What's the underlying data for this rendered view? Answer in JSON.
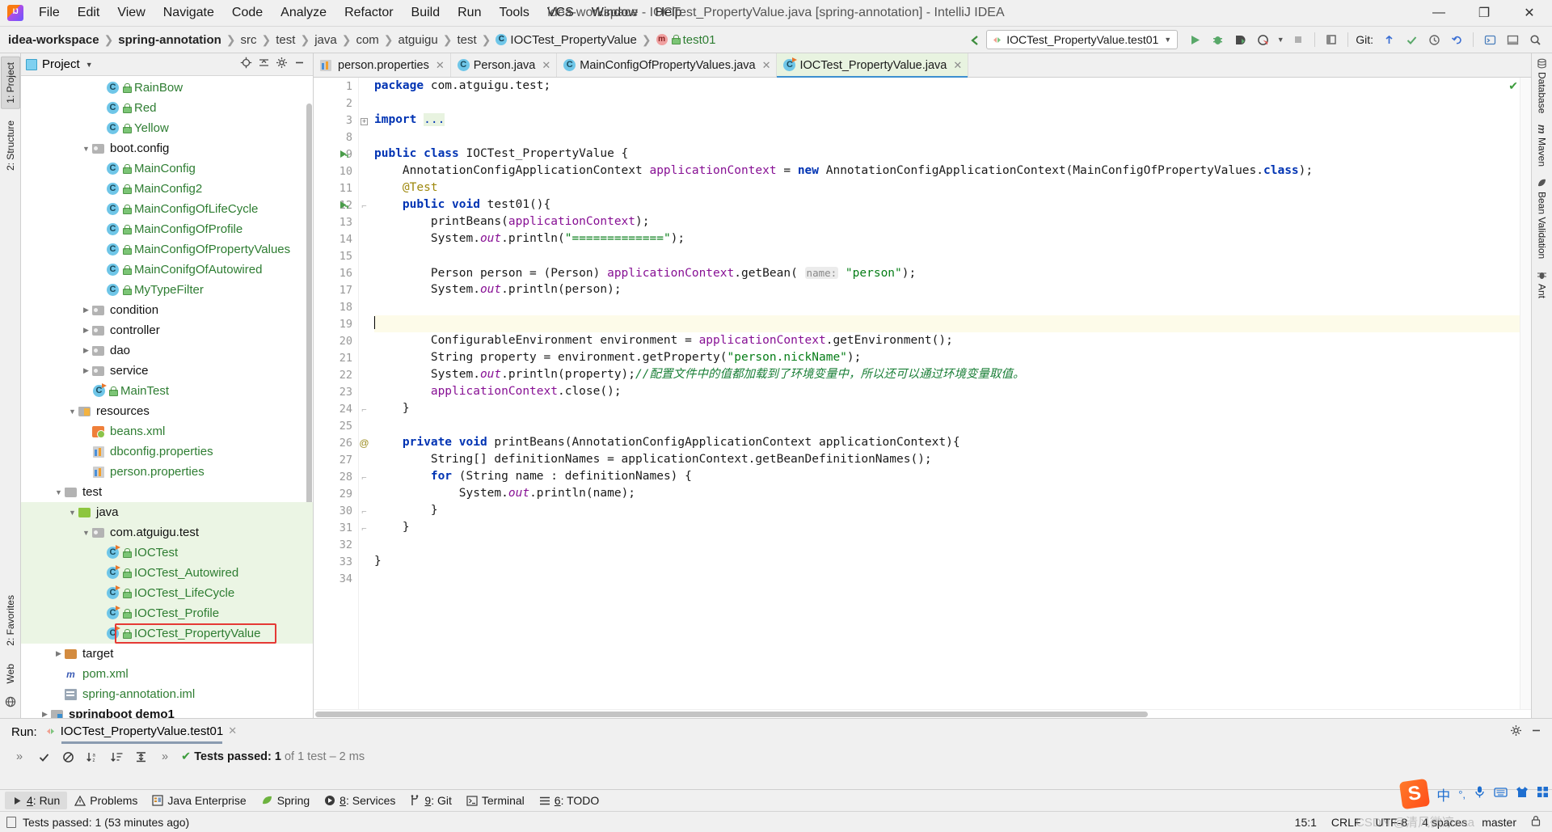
{
  "window": {
    "title": "idea-workspace - IOCTest_PropertyValue.java [spring-annotation] - IntelliJ IDEA",
    "minimize": "—",
    "maximize": "❐",
    "close": "✕"
  },
  "menu": [
    "File",
    "Edit",
    "View",
    "Navigate",
    "Code",
    "Analyze",
    "Refactor",
    "Build",
    "Run",
    "Tools",
    "VCS",
    "Window",
    "Help"
  ],
  "breadcrumb": [
    {
      "label": "idea-workspace",
      "style": "bold"
    },
    {
      "label": "spring-annotation",
      "style": "bold"
    },
    {
      "label": "src",
      "style": "dim"
    },
    {
      "label": "test",
      "style": "dim"
    },
    {
      "label": "java",
      "style": "dim"
    },
    {
      "label": "com",
      "style": "dim"
    },
    {
      "label": "atguigu",
      "style": "dim"
    },
    {
      "label": "test",
      "style": "dim"
    },
    {
      "label": "IOCTest_PropertyValue",
      "style": "class"
    },
    {
      "label": "test01",
      "style": "method"
    }
  ],
  "toolbar": {
    "run_config": "IOCTest_PropertyValue.test01",
    "git_label": "Git:",
    "icons": [
      "run-icon",
      "debug-icon",
      "run-coverage-icon",
      "profile-icon",
      "stop-icon",
      "update-project-icon",
      "commit-icon",
      "history-icon",
      "undo-icon",
      "search-everywhere-icon"
    ]
  },
  "left_rail": {
    "top": [
      {
        "label": "1: Project",
        "selected": true
      },
      {
        "label": "2: Structure",
        "selected": false
      }
    ],
    "bottom": [
      {
        "label": "2: Favorites"
      },
      {
        "label": "Web"
      }
    ]
  },
  "right_rail": [
    {
      "label": "Database",
      "icon": "database-icon"
    },
    {
      "label": "Maven",
      "icon": "maven-icon"
    },
    {
      "label": "Bean Validation",
      "icon": "bean-icon"
    },
    {
      "label": "Ant",
      "icon": "ant-icon"
    }
  ],
  "project_panel": {
    "title": "Project",
    "tools": [
      "locate-icon",
      "collapse-all-icon",
      "settings-icon",
      "hide-icon"
    ],
    "tree": [
      {
        "indent": 5,
        "twisty": "",
        "icon": "class",
        "label": "RainBow",
        "color": "green"
      },
      {
        "indent": 5,
        "twisty": "",
        "icon": "class",
        "label": "Red",
        "color": "green"
      },
      {
        "indent": 5,
        "twisty": "",
        "icon": "class",
        "label": "Yellow",
        "color": "green"
      },
      {
        "indent": 4,
        "twisty": "down",
        "icon": "package",
        "label": "boot.config",
        "color": "dark"
      },
      {
        "indent": 5,
        "twisty": "",
        "icon": "class",
        "label": "MainConfig",
        "color": "green"
      },
      {
        "indent": 5,
        "twisty": "",
        "icon": "class",
        "label": "MainConfig2",
        "color": "green"
      },
      {
        "indent": 5,
        "twisty": "",
        "icon": "class",
        "label": "MainConfigOfLifeCycle",
        "color": "green"
      },
      {
        "indent": 5,
        "twisty": "",
        "icon": "class",
        "label": "MainConfigOfProfile",
        "color": "green"
      },
      {
        "indent": 5,
        "twisty": "",
        "icon": "class",
        "label": "MainConfigOfPropertyValues",
        "color": "green"
      },
      {
        "indent": 5,
        "twisty": "",
        "icon": "class",
        "label": "MainConifgOfAutowired",
        "color": "green"
      },
      {
        "indent": 5,
        "twisty": "",
        "icon": "class",
        "label": "MyTypeFilter",
        "color": "green"
      },
      {
        "indent": 4,
        "twisty": "right",
        "icon": "package",
        "label": "condition",
        "color": "dark"
      },
      {
        "indent": 4,
        "twisty": "right",
        "icon": "package",
        "label": "controller",
        "color": "dark"
      },
      {
        "indent": 4,
        "twisty": "right",
        "icon": "package",
        "label": "dao",
        "color": "dark"
      },
      {
        "indent": 4,
        "twisty": "right",
        "icon": "package",
        "label": "service",
        "color": "dark"
      },
      {
        "indent": 4,
        "twisty": "",
        "icon": "class-run",
        "label": "MainTest",
        "color": "green"
      },
      {
        "indent": 3,
        "twisty": "down",
        "icon": "folder-resources",
        "label": "resources",
        "color": "dark"
      },
      {
        "indent": 4,
        "twisty": "",
        "icon": "xml",
        "label": "beans.xml",
        "color": "green"
      },
      {
        "indent": 4,
        "twisty": "",
        "icon": "properties",
        "label": "dbconfig.properties",
        "color": "green"
      },
      {
        "indent": 4,
        "twisty": "",
        "icon": "properties",
        "label": "person.properties",
        "color": "green"
      },
      {
        "indent": 2,
        "twisty": "down",
        "icon": "folder-plain",
        "label": "test",
        "color": "dark"
      },
      {
        "indent": 3,
        "twisty": "down",
        "icon": "folder-src",
        "label": "java",
        "color": "dark",
        "green_bg": true
      },
      {
        "indent": 4,
        "twisty": "down",
        "icon": "package",
        "label": "com.atguigu.test",
        "color": "dark",
        "green_bg": true
      },
      {
        "indent": 5,
        "twisty": "",
        "icon": "class-run",
        "label": "IOCTest",
        "color": "green",
        "green_bg": true
      },
      {
        "indent": 5,
        "twisty": "",
        "icon": "class-run",
        "label": "IOCTest_Autowired",
        "color": "green",
        "green_bg": true
      },
      {
        "indent": 5,
        "twisty": "",
        "icon": "class-run",
        "label": "IOCTest_LifeCycle",
        "color": "green",
        "green_bg": true
      },
      {
        "indent": 5,
        "twisty": "",
        "icon": "class-run",
        "label": "IOCTest_Profile",
        "color": "green",
        "green_bg": true
      },
      {
        "indent": 5,
        "twisty": "",
        "icon": "class-run",
        "label": "IOCTest_PropertyValue",
        "color": "green",
        "green_bg": true,
        "boxed": true
      },
      {
        "indent": 2,
        "twisty": "right",
        "icon": "folder-target",
        "label": "target",
        "color": "dark"
      },
      {
        "indent": 2,
        "twisty": "",
        "icon": "maven",
        "label": "pom.xml",
        "color": "green"
      },
      {
        "indent": 2,
        "twisty": "",
        "icon": "iml",
        "label": "spring-annotation.iml",
        "color": "green"
      },
      {
        "indent": 1,
        "twisty": "right",
        "icon": "folder-module",
        "label": "springboot demo1",
        "color": "darkbold"
      }
    ]
  },
  "editor_tabs": [
    {
      "label": "person.properties",
      "icon": "properties",
      "active": false,
      "closable": true
    },
    {
      "label": "Person.java",
      "icon": "class",
      "active": false,
      "closable": true
    },
    {
      "label": "MainConfigOfPropertyValues.java",
      "icon": "class",
      "active": false,
      "closable": true
    },
    {
      "label": "IOCTest_PropertyValue.java",
      "icon": "class-run",
      "active": true,
      "closable": true
    }
  ],
  "editor": {
    "line_numbers": [
      "1",
      "2",
      "3",
      "8",
      "9",
      "10",
      "11",
      "12",
      "13",
      "14",
      "15",
      "16",
      "17",
      "18",
      "19",
      "20",
      "21",
      "22",
      "23",
      "24",
      "25",
      "26",
      "27",
      "28",
      "29",
      "30",
      "31",
      "32",
      "33",
      "34"
    ],
    "current_line_index": 14,
    "caret_position": "15:1",
    "lines": [
      {
        "n": "1",
        "html": "<span class=\"k\">package</span> com.atguigu.test;"
      },
      {
        "n": "2",
        "html": ""
      },
      {
        "n": "3",
        "html": "<span class=\"k\">import</span> <span class=\"fold\">...</span>"
      },
      {
        "n": "8",
        "html": ""
      },
      {
        "n": "9",
        "html": "<span class=\"k\">public class</span> IOCTest_PropertyValue {"
      },
      {
        "n": "10",
        "html": "    AnnotationConfigApplicationContext <span class=\"f\">applicationContext</span> = <span class=\"k\">new</span> AnnotationConfigApplicationContext(MainConfigOfPropertyValues.<span class=\"k\">class</span>);"
      },
      {
        "n": "11",
        "html": "    <span class=\"an\">@Test</span>"
      },
      {
        "n": "12",
        "html": "    <span class=\"k\">public void</span> test01(){"
      },
      {
        "n": "13",
        "html": "        printBeans(<span class=\"f\">applicationContext</span>);"
      },
      {
        "n": "14",
        "html": "        System.<span class=\"st\">out</span>.println(<span class=\"s\">\"=============\"</span>);"
      },
      {
        "n": "15",
        "html": ""
      },
      {
        "n": "16",
        "html": "        Person person = (Person) <span class=\"f\">applicationContext</span>.getBean( <span class=\"hint\">name:</span> <span class=\"s\">\"person\"</span>);"
      },
      {
        "n": "17",
        "html": "        System.<span class=\"st\">out</span>.println(person);"
      },
      {
        "n": "18",
        "html": ""
      },
      {
        "n": "19",
        "html": ""
      },
      {
        "n": "20",
        "html": "        ConfigurableEnvironment environment = <span class=\"f\">applicationContext</span>.getEnvironment();"
      },
      {
        "n": "21",
        "html": "        String property = environment.getProperty(<span class=\"s\">\"person.nickName\"</span>);"
      },
      {
        "n": "22",
        "html": "        System.<span class=\"st\">out</span>.println(property);<span class=\"cm\">//配置文件中的值都加载到了环境变量中，所以还可以通过环境变量取值。</span>"
      },
      {
        "n": "23",
        "html": "        <span class=\"f\">applicationContext</span>.close();"
      },
      {
        "n": "24",
        "html": "    }"
      },
      {
        "n": "25",
        "html": ""
      },
      {
        "n": "26",
        "html": "    <span class=\"k\">private void</span> printBeans(AnnotationConfigApplicationContext applicationContext){"
      },
      {
        "n": "27",
        "html": "        String[] definitionNames = applicationContext.getBeanDefinitionNames();"
      },
      {
        "n": "28",
        "html": "        <span class=\"k\">for</span> (String name : definitionNames) {"
      },
      {
        "n": "29",
        "html": "            System.<span class=\"st\">out</span>.println(name);"
      },
      {
        "n": "30",
        "html": "        }"
      },
      {
        "n": "31",
        "html": "    }"
      },
      {
        "n": "32",
        "html": ""
      },
      {
        "n": "33",
        "html": "}"
      },
      {
        "n": "34",
        "html": ""
      }
    ]
  },
  "run_panel": {
    "label": "Run:",
    "tab": "IOCTest_PropertyValue.test01",
    "toolbar_icons": [
      "expand-icon",
      "show-passed-icon",
      "hide-ignored-icon",
      "sort-alpha-icon",
      "sort-duration-icon",
      "expand-collapse-icon",
      "more-icon"
    ],
    "result_prefix": "Tests passed:",
    "result_count": "1",
    "result_suffix": "of 1 test – 2 ms",
    "settings_icon": "gear-icon",
    "minimize_icon": "minimize-icon"
  },
  "bottom_bar": [
    {
      "num": "4",
      "label": ": Run",
      "icon": "run-icon",
      "selected": true
    },
    {
      "num": "",
      "label": "Problems",
      "icon": "warning-icon",
      "selected": false
    },
    {
      "num": "",
      "label": "Java Enterprise",
      "icon": "jee-icon",
      "selected": false
    },
    {
      "num": "",
      "label": "Spring",
      "icon": "spring-icon",
      "selected": false
    },
    {
      "num": "8",
      "label": ": Services",
      "icon": "services-icon",
      "selected": false
    },
    {
      "num": "9",
      "label": ": Git",
      "icon": "git-icon",
      "selected": false
    },
    {
      "num": "",
      "label": "Terminal",
      "icon": "terminal-icon",
      "selected": false
    },
    {
      "num": "6",
      "label": ": TODO",
      "icon": "todo-icon",
      "selected": false
    }
  ],
  "status_bar": {
    "message": "Tests passed: 1 (53 minutes ago)",
    "caret": "15:1",
    "line_sep": "CRLF",
    "encoding": "UTF-8",
    "indent": "4 spaces",
    "branch": "master",
    "watermark": "CSDN @清风微凉aaa"
  }
}
